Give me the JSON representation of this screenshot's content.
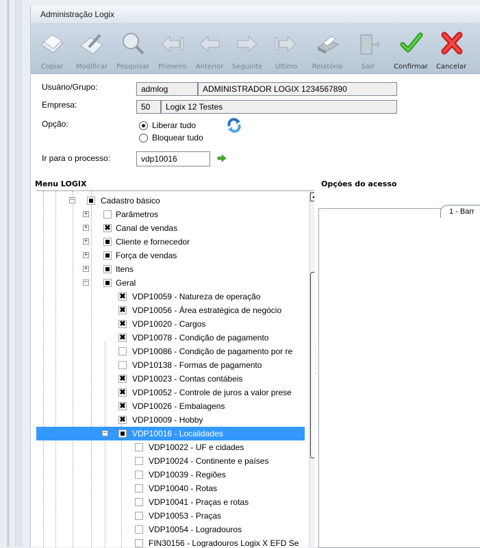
{
  "window": {
    "title": "Administração Logix"
  },
  "toolbar": {
    "buttons": [
      {
        "label": "Copiar",
        "icon": "copy-icon",
        "enabled": false
      },
      {
        "label": "Modificar",
        "icon": "modify-icon",
        "enabled": false
      },
      {
        "label": "Pesquisar",
        "icon": "search-icon",
        "enabled": false
      },
      {
        "label": "Primeiro",
        "icon": "first-icon",
        "enabled": false
      },
      {
        "label": "Anterior",
        "icon": "previous-icon",
        "enabled": false
      },
      {
        "label": "Seguinte",
        "icon": "next-icon",
        "enabled": false
      },
      {
        "label": "Último",
        "icon": "last-icon",
        "enabled": false
      },
      {
        "label": "Relatório",
        "icon": "printer-icon",
        "enabled": false
      },
      {
        "label": "Sair",
        "icon": "exit-door-icon",
        "enabled": false
      },
      {
        "label": "Confirmar",
        "icon": "checkmark-icon",
        "enabled": true
      },
      {
        "label": "Cancelar",
        "icon": "cancel-x-icon",
        "enabled": true
      }
    ]
  },
  "form": {
    "user_label": "Usuário/Grupo:",
    "user_code": "admlog",
    "user_name": "ADMINISTRADOR LOGIX 1234567890",
    "company_label": "Empresa:",
    "company_code": "50",
    "company_name": "Logix 12 Testes",
    "option_label": "Opção:",
    "option_release_all": "Liberar tudo",
    "option_block_all": "Bloquear tudo",
    "selected_option": "Liberar tudo",
    "goto_label": "Ir para o processo:",
    "goto_value": "vdp10016"
  },
  "menu": {
    "title": "Menu LOGIX",
    "items": [
      {
        "label": "Cadastro básico",
        "level": 0,
        "state": "partial",
        "expander": "minus"
      },
      {
        "label": "Parâmetros",
        "level": 1,
        "state": "empty",
        "expander": "plus"
      },
      {
        "label": "Canal de vendas",
        "level": 1,
        "state": "checked",
        "expander": "plus"
      },
      {
        "label": "Cliente e fornecedor",
        "level": 1,
        "state": "partial",
        "expander": "plus"
      },
      {
        "label": "Força de vendas",
        "level": 1,
        "state": "partial",
        "expander": "plus"
      },
      {
        "label": "Itens",
        "level": 1,
        "state": "partial",
        "expander": "plus"
      },
      {
        "label": "Geral",
        "level": 1,
        "state": "partial",
        "expander": "minus"
      },
      {
        "label": "VDP10059 - Natureza de operação",
        "level": 2,
        "state": "checked",
        "expander": ""
      },
      {
        "label": "VDP10056 - Área estratégica de negócio",
        "level": 2,
        "state": "checked",
        "expander": ""
      },
      {
        "label": "VDP10020 - Cargos",
        "level": 2,
        "state": "checked",
        "expander": ""
      },
      {
        "label": "VDP10078 - Condição de pagamento",
        "level": 2,
        "state": "checked",
        "expander": ""
      },
      {
        "label": "VDP10086 - Condição de pagamento por re",
        "level": 2,
        "state": "empty",
        "expander": ""
      },
      {
        "label": "VDP10138 - Formas de pagamento",
        "level": 2,
        "state": "empty",
        "expander": ""
      },
      {
        "label": "VDP10023 - Contas contábeis",
        "level": 2,
        "state": "checked",
        "expander": ""
      },
      {
        "label": "VDP10052 - Controle de juros a valor prese",
        "level": 2,
        "state": "checked",
        "expander": ""
      },
      {
        "label": "VDP10026 - Embalagens",
        "level": 2,
        "state": "checked",
        "expander": ""
      },
      {
        "label": "VDP10009 - Hobby",
        "level": 2,
        "state": "checked",
        "expander": ""
      },
      {
        "label": "VDP10016 - Localidades",
        "level": 2,
        "state": "partial",
        "expander": "minus",
        "selected": true
      },
      {
        "label": "VDP10022 - UF e cidades",
        "level": 3,
        "state": "empty",
        "expander": ""
      },
      {
        "label": "VDP10024 - Continente e países",
        "level": 3,
        "state": "empty",
        "expander": ""
      },
      {
        "label": "VDP10039 - Regiões",
        "level": 3,
        "state": "empty",
        "expander": ""
      },
      {
        "label": "VDP10040 - Rotas",
        "level": 3,
        "state": "empty",
        "expander": ""
      },
      {
        "label": "VDP10041 - Praças e rotas",
        "level": 3,
        "state": "empty",
        "expander": ""
      },
      {
        "label": "VDP10053 - Praças",
        "level": 3,
        "state": "empty",
        "expander": ""
      },
      {
        "label": "VDP10054 - Logradouros",
        "level": 3,
        "state": "empty",
        "expander": ""
      },
      {
        "label": "FIN30156 - Logradouros Logix X EFD Se",
        "level": 3,
        "state": "empty",
        "expander": ""
      }
    ]
  },
  "access_options": {
    "title": "Opções do acesso",
    "tab_label": "1 - Barr"
  }
}
